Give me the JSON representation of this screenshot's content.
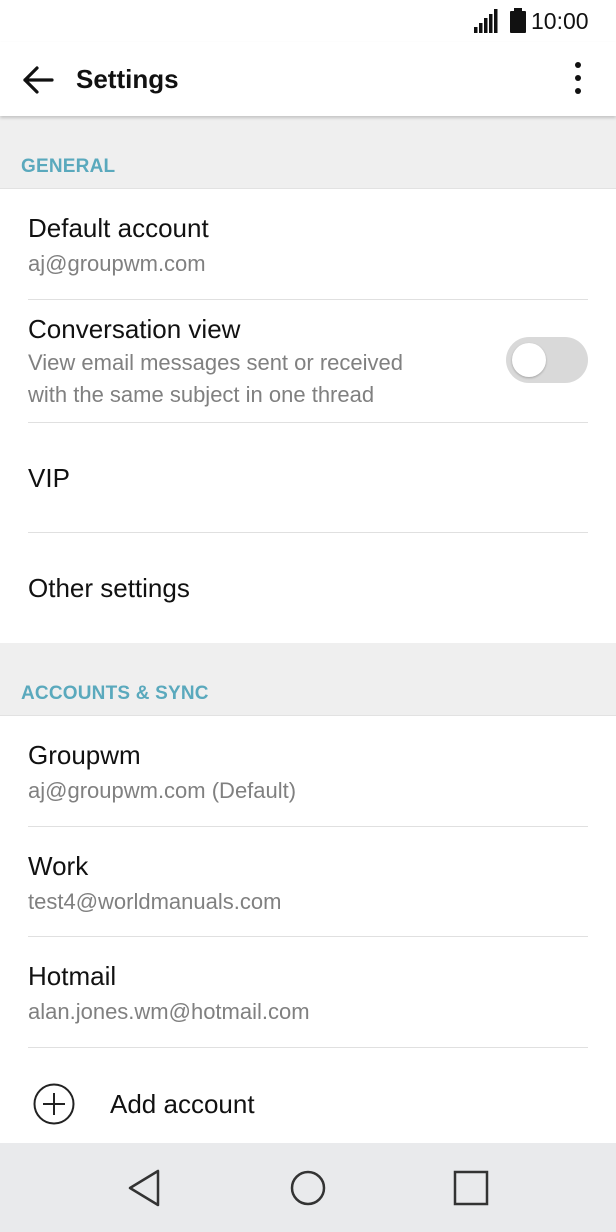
{
  "status_bar": {
    "time": "10:00",
    "icons": [
      "signal-icon",
      "battery-icon"
    ]
  },
  "app_bar": {
    "title": "Settings",
    "back_icon": "back-arrow-icon",
    "menu_icon": "overflow-menu-icon"
  },
  "sections": {
    "general": {
      "header": "GENERAL",
      "default_account": {
        "title": "Default account",
        "subtitle": "aj@groupwm.com"
      },
      "conversation_view": {
        "title": "Conversation view",
        "subtitle_line1": "View email messages sent or received",
        "subtitle_line2": "with the same subject in one thread",
        "enabled": false
      },
      "vip": {
        "title": "VIP"
      },
      "other_settings": {
        "title": "Other settings"
      }
    },
    "accounts_sync": {
      "header": "ACCOUNTS & SYNC",
      "accounts": [
        {
          "name": "Groupwm",
          "email": "aj@groupwm.com (Default)"
        },
        {
          "name": "Work",
          "email": "test4@worldmanuals.com"
        },
        {
          "name": "Hotmail",
          "email": "alan.jones.wm@hotmail.com"
        }
      ],
      "add_account": "Add account"
    }
  },
  "nav_bar": {
    "icons": [
      "back-triangle-icon",
      "home-circle-icon",
      "recents-square-icon"
    ]
  },
  "colors": {
    "accent": "#5aa9bd",
    "section_background": "#efefef",
    "toggle_off": "#d9d9d9",
    "nav_background": "#e9eaec"
  }
}
